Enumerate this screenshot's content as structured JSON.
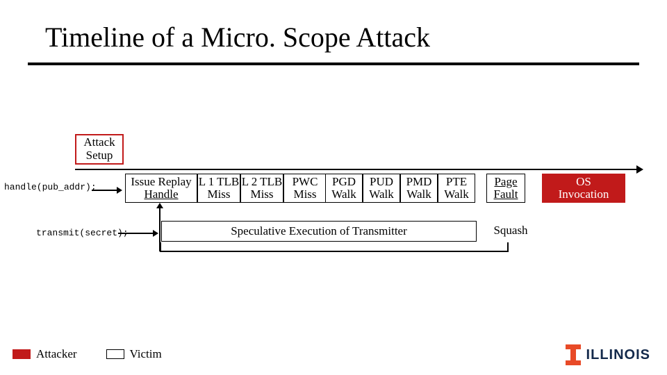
{
  "title": "Timeline of a Micro. Scope Attack",
  "attack_setup": {
    "line1": "Attack",
    "line2": "Setup"
  },
  "labels": {
    "handle": "handle(pub_addr);",
    "transmit": "transmit(secret);"
  },
  "row1": {
    "issue": {
      "l1": "Issue Replay",
      "l2": "Handle"
    },
    "l1tlb": {
      "l1": "L 1 TLB",
      "l2": "Miss"
    },
    "l2tlb": {
      "l1": "L 2 TLB",
      "l2": "Miss"
    },
    "pwc": {
      "l1": "PWC",
      "l2": "Miss"
    },
    "pgd": {
      "l1": "PGD",
      "l2": "Walk"
    },
    "pud": {
      "l1": "PUD",
      "l2": "Walk"
    },
    "pmd": {
      "l1": "PMD",
      "l2": "Walk"
    },
    "pte": {
      "l1": "PTE",
      "l2": "Walk"
    },
    "page_fault": {
      "l1": "Page",
      "l2": "Fault"
    },
    "os": {
      "l1": "OS",
      "l2": "Invocation"
    }
  },
  "row2": {
    "spec": "Speculative Execution of Transmitter",
    "squash": "Squash"
  },
  "legend": {
    "attacker": "Attacker",
    "victim": "Victim"
  },
  "logo": {
    "word": "ILLINOIS"
  },
  "colors": {
    "accent": "#c11a1a",
    "illinois_orange": "#E84A27",
    "illinois_blue": "#13294B"
  }
}
